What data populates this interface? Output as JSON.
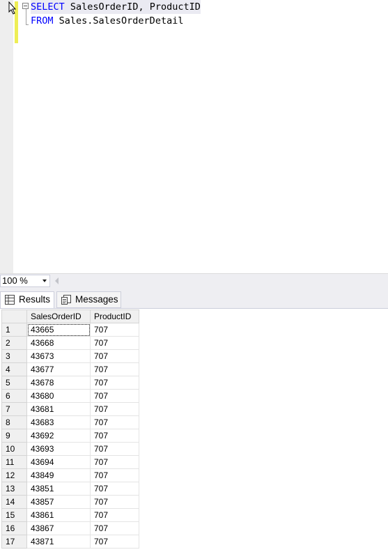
{
  "editor": {
    "line1": {
      "keyword": "SELECT",
      "rest": " SalesOrderID, ProductID"
    },
    "line2": {
      "keyword": "FROM",
      "rest": " Sales.SalesOrderDetail"
    }
  },
  "zoom": {
    "value": "100 %"
  },
  "tabs": {
    "results": "Results",
    "messages": "Messages"
  },
  "grid": {
    "columns": [
      "SalesOrderID",
      "ProductID"
    ],
    "rows": [
      [
        "1",
        "43665",
        "707"
      ],
      [
        "2",
        "43668",
        "707"
      ],
      [
        "3",
        "43673",
        "707"
      ],
      [
        "4",
        "43677",
        "707"
      ],
      [
        "5",
        "43678",
        "707"
      ],
      [
        "6",
        "43680",
        "707"
      ],
      [
        "7",
        "43681",
        "707"
      ],
      [
        "8",
        "43683",
        "707"
      ],
      [
        "9",
        "43692",
        "707"
      ],
      [
        "10",
        "43693",
        "707"
      ],
      [
        "11",
        "43694",
        "707"
      ],
      [
        "12",
        "43849",
        "707"
      ],
      [
        "13",
        "43851",
        "707"
      ],
      [
        "14",
        "43857",
        "707"
      ],
      [
        "15",
        "43861",
        "707"
      ],
      [
        "16",
        "43867",
        "707"
      ],
      [
        "17",
        "43871",
        "707"
      ]
    ]
  },
  "icons": {
    "cursor": "mouse-cursor-icon",
    "results": "grid-icon",
    "messages": "messages-icon"
  }
}
